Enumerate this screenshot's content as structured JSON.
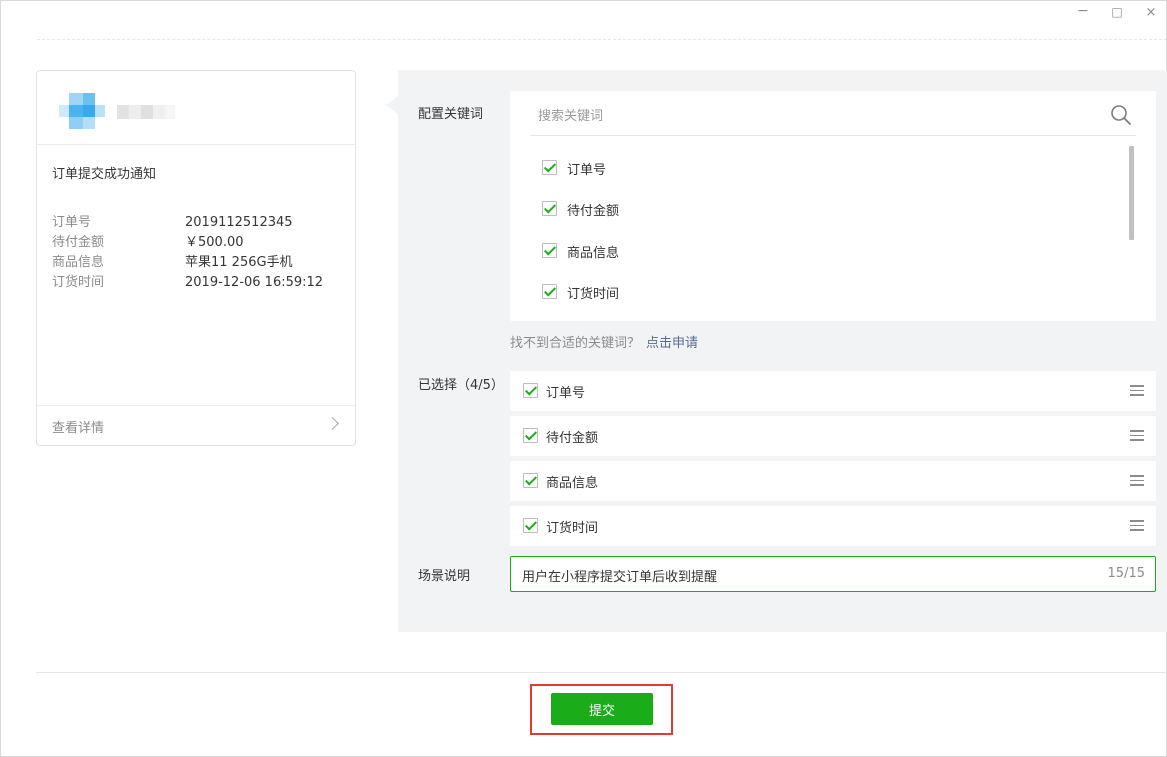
{
  "window": {
    "minimize": "−",
    "maximize": "□",
    "close": "×"
  },
  "card": {
    "title": "订单提交成功通知",
    "fields": [
      {
        "label": "订单号",
        "value": "2019112512345"
      },
      {
        "label": "待付金额",
        "value": "￥500.00"
      },
      {
        "label": "商品信息",
        "value": "苹果11 256G手机"
      },
      {
        "label": "订货时间",
        "value": "2019-12-06 16:59:12"
      }
    ],
    "footer_label": "查看详情"
  },
  "config": {
    "keyword_label": "配置关键词",
    "search_placeholder": "搜索关键词",
    "keywords": [
      "订单号",
      "待付金额",
      "商品信息",
      "订货时间"
    ],
    "hint_text": "找不到合适的关键词？",
    "hint_link": "点击申请",
    "selected_label": "已选择（4/5）",
    "selected": [
      "订单号",
      "待付金额",
      "商品信息",
      "订货时间"
    ],
    "scene_label": "场景说明",
    "scene_value": "用户在小程序提交订单后收到提醒",
    "scene_count": "15/15"
  },
  "submit_label": "提交",
  "colors": {
    "accent": "#1aad19",
    "link": "#576b95",
    "highlight": "#e53935"
  }
}
